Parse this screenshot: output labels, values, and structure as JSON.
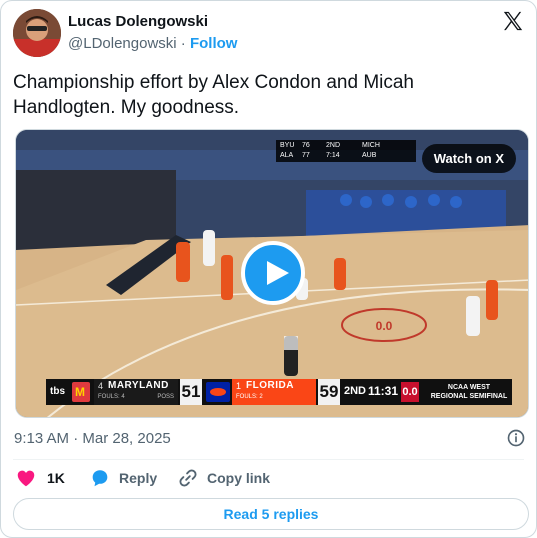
{
  "author": {
    "name": "Lucas Dolengowski",
    "handle": "@LDolengowski",
    "separator": "·",
    "follow_label": "Follow"
  },
  "tweet": {
    "text_line1": "Championship effort by Alex Condon and Micah",
    "text_line2": "Handlogten. My goodness."
  },
  "media": {
    "watch_label": "Watch on X",
    "scorebug": {
      "network": "tbs",
      "team1_seed": "4",
      "team1_name": "MARYLAND",
      "team1_fouls": "FOULS: 4",
      "team1_poss": "POSS",
      "team1_score": "51",
      "team2_seed": "1",
      "team2_name": "FLORIDA",
      "team2_fouls": "FOULS: 2",
      "team2_score": "59",
      "period": "2ND",
      "clock": "11:31",
      "shot_clock": "0.0",
      "event_line1": "NCAA WEST",
      "event_line2": "REGIONAL SEMIFINAL"
    },
    "arena_board": {
      "t1": "BYU",
      "s1": "76",
      "t2": "ALA",
      "s2": "77",
      "per": "2ND",
      "clk": "7:14",
      "t3": "MICH",
      "t4": "AUB"
    },
    "court_logo": "0.0"
  },
  "meta": {
    "timestamp": "9:13 AM · Mar 28, 2025"
  },
  "actions": {
    "like_count": "1K",
    "reply_label": "Reply",
    "copy_label": "Copy link"
  },
  "read_replies_label": "Read 5 replies",
  "colors": {
    "accent": "#1d9bf0",
    "like": "#f91880",
    "text_secondary": "#536471",
    "florida": "#fa4616",
    "maryland": "#e03a3e"
  }
}
